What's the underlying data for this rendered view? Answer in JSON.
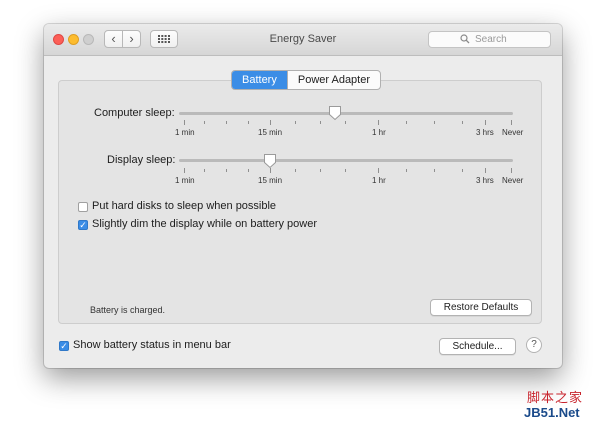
{
  "window": {
    "title": "Energy Saver",
    "search_placeholder": "Search",
    "back_glyph": "‹",
    "forward_glyph": "›",
    "icons": {
      "back": "chevron-left-icon",
      "forward": "chevron-right-icon",
      "show_all": "grid-icon",
      "search": "magnifier-icon"
    }
  },
  "tabs": [
    {
      "label": "Battery",
      "selected": true
    },
    {
      "label": "Power Adapter",
      "selected": false
    }
  ],
  "sliders": [
    {
      "label": "Computer sleep:",
      "value_label": "30 min",
      "scale": [
        "1 min",
        "15 min",
        "1 hr",
        "3 hrs",
        "Never"
      ]
    },
    {
      "label": "Display sleep:",
      "value_label": "15 min",
      "scale": [
        "1 min",
        "15 min",
        "1 hr",
        "3 hrs",
        "Never"
      ]
    }
  ],
  "options": [
    {
      "label": "Put hard disks to sleep when possible",
      "checked": false
    },
    {
      "label": "Slightly dim the display while on battery power",
      "checked": true
    }
  ],
  "status": "Battery is charged.",
  "restore_label": "Restore Defaults",
  "footer": {
    "show_status_label": "Show battery status in menu bar",
    "show_status_checked": true,
    "schedule_label": "Schedule...",
    "help_label": "?"
  },
  "watermark": {
    "line1": "脚本之家",
    "line2": "JB51.Net"
  },
  "colors": {
    "accent": "#3b8de6",
    "close": "#fc5f57",
    "minimize": "#fdbc2e",
    "watermark_red": "#c8232c",
    "watermark_blue": "#1a4a8a"
  }
}
